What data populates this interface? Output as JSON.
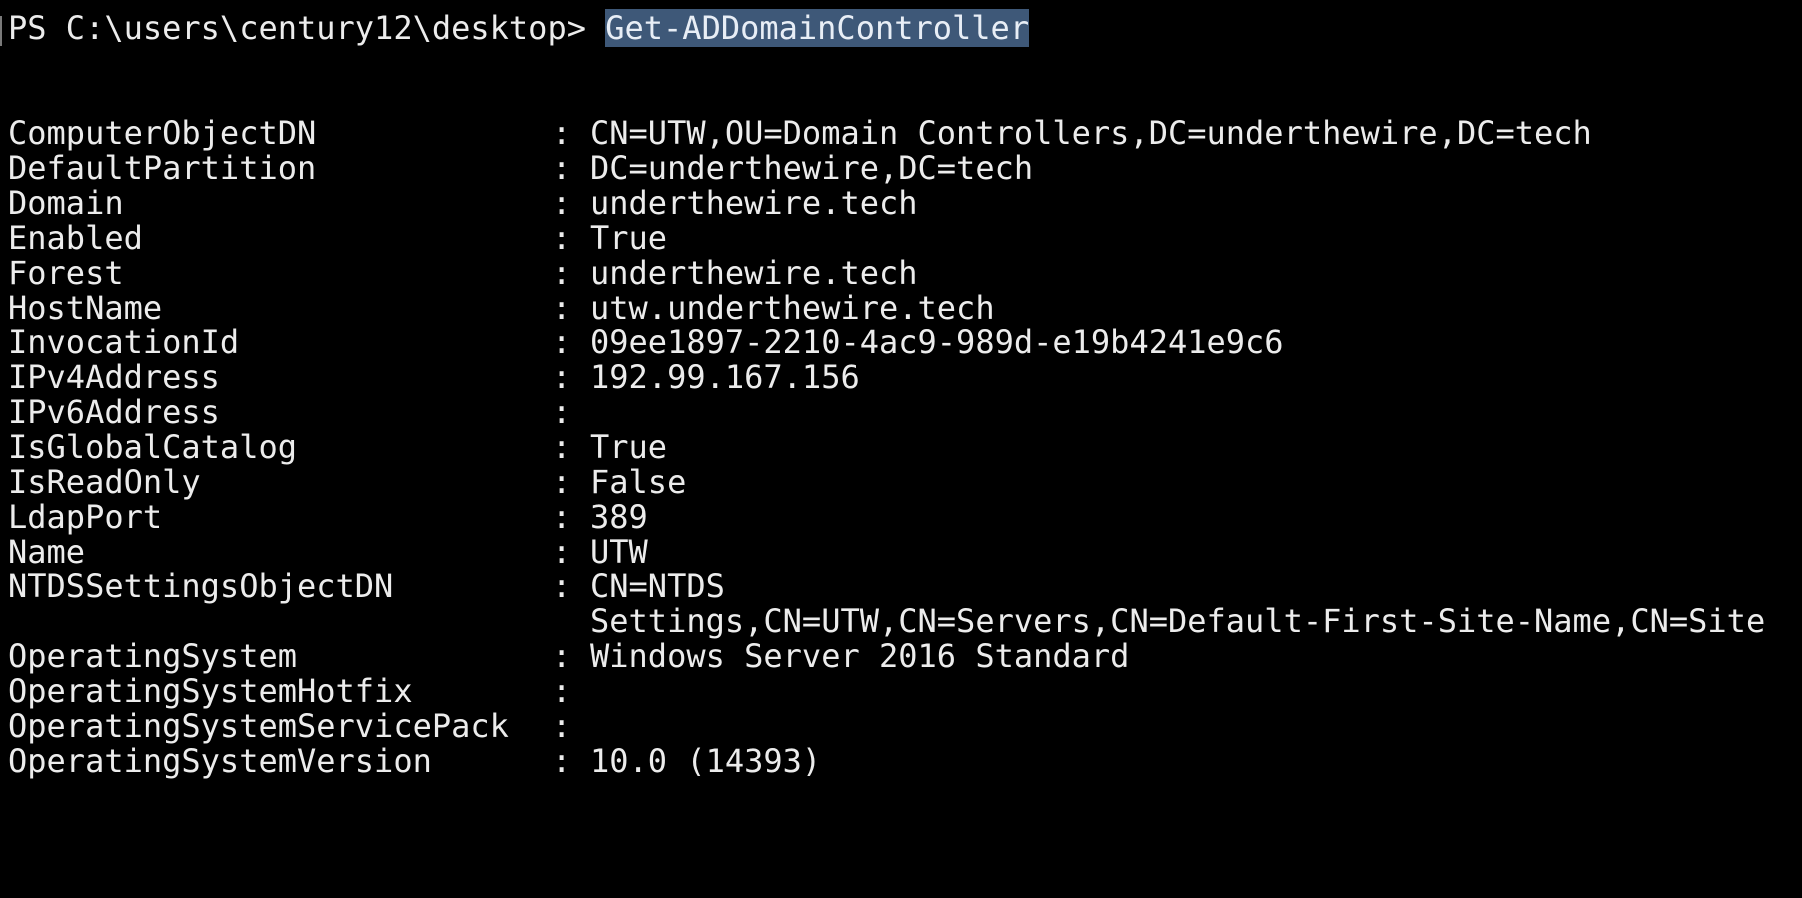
{
  "prompt": {
    "text": "PS C:\\users\\century12\\desktop> ",
    "command": "Get-ADDomainController"
  },
  "separator": ":",
  "properties": [
    {
      "key": "ComputerObjectDN",
      "value": "CN=UTW,OU=Domain Controllers,DC=underthewire,DC=tech"
    },
    {
      "key": "DefaultPartition",
      "value": "DC=underthewire,DC=tech"
    },
    {
      "key": "Domain",
      "value": "underthewire.tech"
    },
    {
      "key": "Enabled",
      "value": "True"
    },
    {
      "key": "Forest",
      "value": "underthewire.tech"
    },
    {
      "key": "HostName",
      "value": "utw.underthewire.tech"
    },
    {
      "key": "InvocationId",
      "value": "09ee1897-2210-4ac9-989d-e19b4241e9c6"
    },
    {
      "key": "IPv4Address",
      "value": "192.99.167.156"
    },
    {
      "key": "IPv6Address",
      "value": ""
    },
    {
      "key": "IsGlobalCatalog",
      "value": "True"
    },
    {
      "key": "IsReadOnly",
      "value": "False"
    },
    {
      "key": "LdapPort",
      "value": "389"
    },
    {
      "key": "Name",
      "value": "UTW"
    },
    {
      "key": "NTDSSettingsObjectDN",
      "value": "CN=NTDS",
      "continuation": "Settings,CN=UTW,CN=Servers,CN=Default-First-Site-Name,CN=Site"
    },
    {
      "key": "OperatingSystem",
      "value": "Windows Server 2016 Standard"
    },
    {
      "key": "OperatingSystemHotfix",
      "value": ""
    },
    {
      "key": "OperatingSystemServicePack",
      "value": ""
    },
    {
      "key": "OperatingSystemVersion",
      "value": "10.0 (14393)"
    }
  ],
  "colors": {
    "background": "#000000",
    "text": "#ececec",
    "selection": "#3e5878"
  }
}
